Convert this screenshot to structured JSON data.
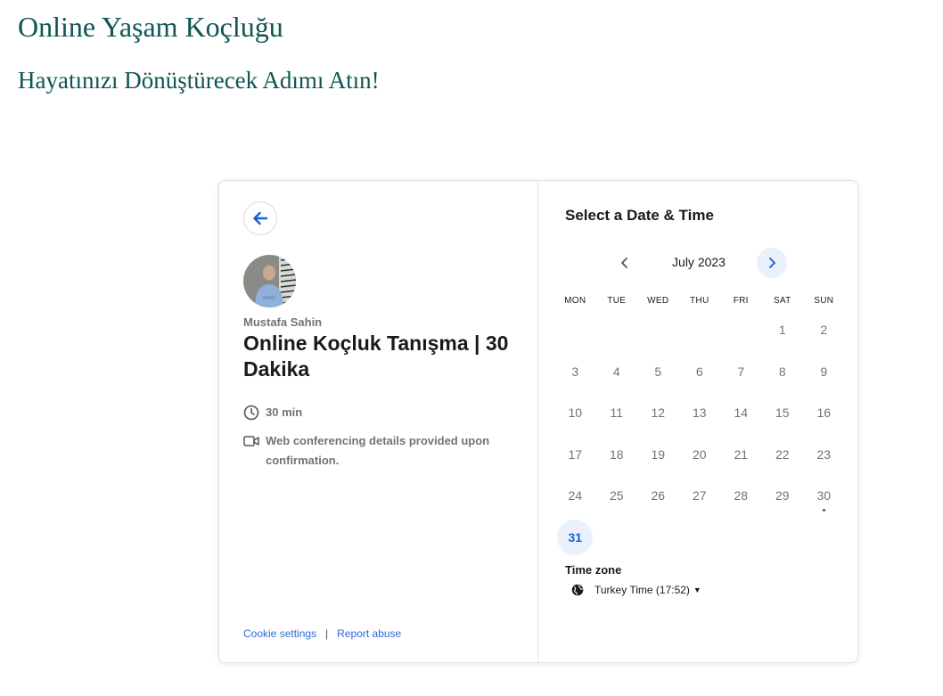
{
  "page": {
    "title": "Online Yaşam Koçluğu",
    "subtitle": "Hayatınızı Dönüştürecek Adımı Atın!"
  },
  "event": {
    "host_name": "Mustafa Sahin",
    "title": "Online Koçluk Tanışma | 30 Dakika",
    "duration": "30 min",
    "conferencing": "Web conferencing details provided upon confirmation."
  },
  "footer": {
    "cookie_settings": "Cookie settings",
    "separator": "|",
    "report_abuse": "Report abuse"
  },
  "calendar": {
    "heading": "Select a Date & Time",
    "month_label": "July 2023",
    "weekdays": [
      "MON",
      "TUE",
      "WED",
      "THU",
      "FRI",
      "SAT",
      "SUN"
    ],
    "weeks": [
      [
        "",
        "",
        "",
        "",
        "",
        "1",
        "2"
      ],
      [
        "3",
        "4",
        "5",
        "6",
        "7",
        "8",
        "9"
      ],
      [
        "10",
        "11",
        "12",
        "13",
        "14",
        "15",
        "16"
      ],
      [
        "17",
        "18",
        "19",
        "20",
        "21",
        "22",
        "23"
      ],
      [
        "24",
        "25",
        "26",
        "27",
        "28",
        "29",
        "30"
      ],
      [
        "31",
        "",
        "",
        "",
        "",
        "",
        ""
      ]
    ],
    "available_days": [
      "31"
    ],
    "today": "30"
  },
  "timezone": {
    "label": "Time zone",
    "value": "Turkey Time (17:52)"
  },
  "icons": {
    "back": "arrow-left-icon",
    "prev": "chevron-left-icon",
    "next": "chevron-right-icon",
    "duration": "clock-icon",
    "conferencing": "video-camera-icon",
    "timezone": "globe-icon",
    "dropdown": "caret-down-icon"
  },
  "colors": {
    "brand_green": "#0f5550",
    "accent_blue": "#1a5fd1",
    "available_bg": "#eaf1fd",
    "muted_text": "#737373"
  }
}
